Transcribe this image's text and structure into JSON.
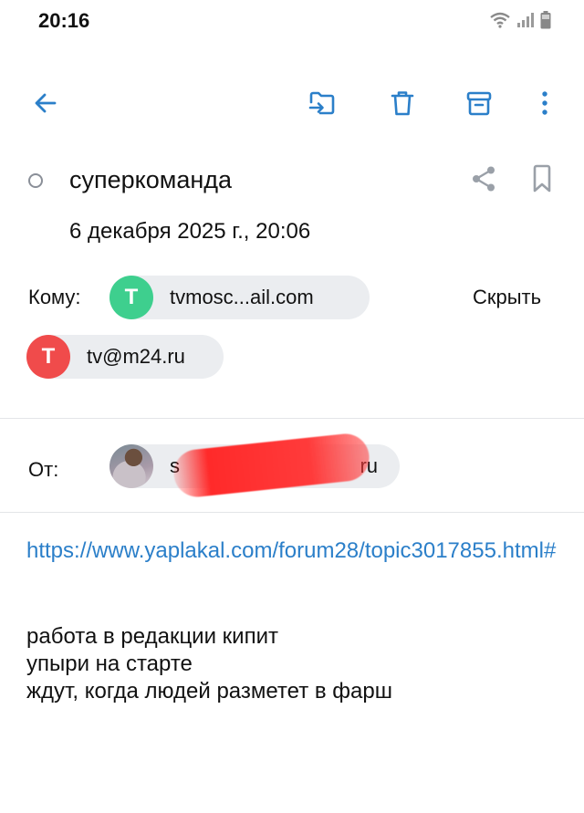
{
  "status_bar": {
    "time": "20:16"
  },
  "toolbar": {
    "back_icon": "arrow-left-icon",
    "move_icon": "move-to-folder-icon",
    "delete_icon": "trash-icon",
    "archive_icon": "archive-icon",
    "more_icon": "more-vertical-icon"
  },
  "message": {
    "subject": "суперкоманда",
    "date": "6 декабря 2025 г., 20:06",
    "to_label": "Кому:",
    "hide_label": "Скрыть",
    "recipients": [
      {
        "initial": "T",
        "address": "tvmosc...ail.com",
        "color": "#3ecf8e"
      },
      {
        "initial": "T",
        "address": "tv@m24.ru",
        "color": "#f04b4b"
      }
    ],
    "from_label": "От:",
    "sender": {
      "address_start": "s",
      "address_end": "ru"
    },
    "link": "https://www.yaplakal.com/forum28/topic3017855.html#",
    "body_lines": [
      "работа в редакции кипит",
      "упыри на старте",
      "ждут, когда людей разметет в фарш"
    ]
  },
  "colors": {
    "accent": "#2b7fc9",
    "chip_bg": "#ebedf0",
    "redaction": "#ff2a2a"
  }
}
